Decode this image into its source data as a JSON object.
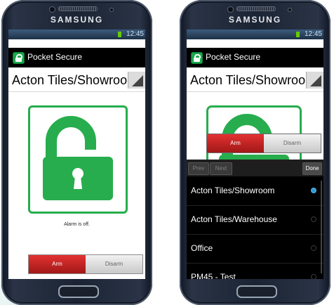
{
  "brand": "SAMSUNG",
  "status": {
    "time": "12:45"
  },
  "app": {
    "title": "Pocket Secure"
  },
  "left": {
    "location": "Acton Tiles/Showroom",
    "alarm_status": "Alarm is off.",
    "arm_label": "Arm",
    "disarm_label": "Disarm"
  },
  "right": {
    "location": "Acton Tiles/Showroom",
    "arm_label": "Arm",
    "disarm_label": "Disarm",
    "picker": {
      "prev_label": "Prev",
      "next_label": "Next",
      "done_label": "Done",
      "items": [
        {
          "label": "Acton Tiles/Showroom",
          "selected": true
        },
        {
          "label": "Acton Tiles/Warehouse",
          "selected": false
        },
        {
          "label": "Office",
          "selected": false
        },
        {
          "label": "PM45 - Test",
          "selected": false
        }
      ]
    }
  },
  "colors": {
    "accent_green": "#27ad4d",
    "arm_red": "#c62222",
    "selected_blue": "#2f9bd6"
  }
}
